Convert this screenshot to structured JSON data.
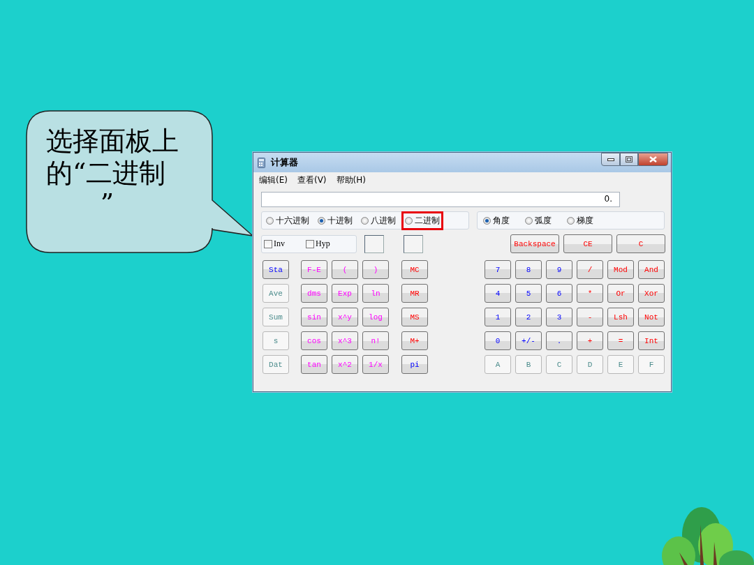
{
  "callout": {
    "lines": [
      "选择面板上",
      "的“二进制",
      "”"
    ]
  },
  "calculator": {
    "title": "计算器",
    "menu": [
      "编辑(E)",
      "查看(V)",
      "帮助(H)"
    ],
    "display": "0.",
    "number_systems": [
      {
        "label": "十六进制",
        "selected": false,
        "highlighted": false
      },
      {
        "label": "十进制",
        "selected": true,
        "highlighted": false
      },
      {
        "label": "八进制",
        "selected": false,
        "highlighted": false
      },
      {
        "label": "二进制",
        "selected": false,
        "highlighted": true
      }
    ],
    "angle_units": [
      {
        "label": "角度",
        "selected": true
      },
      {
        "label": "弧度",
        "selected": false
      },
      {
        "label": "梯度",
        "selected": false
      }
    ],
    "checkboxes": [
      {
        "label": "Inv",
        "checked": false
      },
      {
        "label": "Hyp",
        "checked": false
      }
    ],
    "edit_keys": [
      {
        "label": "Backspace",
        "kind": "operator"
      },
      {
        "label": "CE",
        "kind": "operator"
      },
      {
        "label": "C",
        "kind": "operator"
      }
    ],
    "stat_keys": [
      {
        "label": "Sta",
        "kind": "number",
        "disabled": false
      },
      {
        "label": "Ave",
        "kind": "number",
        "disabled": true
      },
      {
        "label": "Sum",
        "kind": "number",
        "disabled": true
      },
      {
        "label": "s",
        "kind": "number",
        "disabled": true
      },
      {
        "label": "Dat",
        "kind": "number",
        "disabled": true
      }
    ],
    "function_keys": [
      {
        "label": "F-E",
        "kind": "function",
        "disabled": false
      },
      {
        "label": "(",
        "kind": "function",
        "disabled": false
      },
      {
        "label": ")",
        "kind": "function",
        "disabled": false
      },
      {
        "label": "dms",
        "kind": "function",
        "disabled": false
      },
      {
        "label": "Exp",
        "kind": "function",
        "disabled": false
      },
      {
        "label": "ln",
        "kind": "function",
        "disabled": false
      },
      {
        "label": "sin",
        "kind": "function",
        "disabled": false
      },
      {
        "label": "x^y",
        "kind": "function",
        "disabled": false
      },
      {
        "label": "log",
        "kind": "function",
        "disabled": false
      },
      {
        "label": "cos",
        "kind": "function",
        "disabled": false
      },
      {
        "label": "x^3",
        "kind": "function",
        "disabled": false
      },
      {
        "label": "n!",
        "kind": "function",
        "disabled": false
      },
      {
        "label": "tan",
        "kind": "function",
        "disabled": false
      },
      {
        "label": "x^2",
        "kind": "function",
        "disabled": false
      },
      {
        "label": "1/x",
        "kind": "function",
        "disabled": false
      }
    ],
    "memory_keys": [
      {
        "label": "MC",
        "kind": "operator",
        "disabled": false
      },
      {
        "label": "MR",
        "kind": "operator",
        "disabled": false
      },
      {
        "label": "MS",
        "kind": "operator",
        "disabled": false
      },
      {
        "label": "M+",
        "kind": "operator",
        "disabled": false
      },
      {
        "label": "pi",
        "kind": "number",
        "disabled": false
      }
    ],
    "number_keys": [
      {
        "label": "7",
        "kind": "number",
        "disabled": false
      },
      {
        "label": "8",
        "kind": "number",
        "disabled": false
      },
      {
        "label": "9",
        "kind": "number",
        "disabled": false
      },
      {
        "label": "/",
        "kind": "operator",
        "disabled": false
      },
      {
        "label": "Mod",
        "kind": "operator",
        "disabled": false
      },
      {
        "label": "And",
        "kind": "operator",
        "disabled": false
      },
      {
        "label": "4",
        "kind": "number",
        "disabled": false
      },
      {
        "label": "5",
        "kind": "number",
        "disabled": false
      },
      {
        "label": "6",
        "kind": "number",
        "disabled": false
      },
      {
        "label": "*",
        "kind": "operator",
        "disabled": false
      },
      {
        "label": "Or",
        "kind": "operator",
        "disabled": false
      },
      {
        "label": "Xor",
        "kind": "operator",
        "disabled": false
      },
      {
        "label": "1",
        "kind": "number",
        "disabled": false
      },
      {
        "label": "2",
        "kind": "number",
        "disabled": false
      },
      {
        "label": "3",
        "kind": "number",
        "disabled": false
      },
      {
        "label": "-",
        "kind": "operator",
        "disabled": false
      },
      {
        "label": "Lsh",
        "kind": "operator",
        "disabled": false
      },
      {
        "label": "Not",
        "kind": "operator",
        "disabled": false
      },
      {
        "label": "0",
        "kind": "number",
        "disabled": false
      },
      {
        "label": "+/-",
        "kind": "number",
        "disabled": false
      },
      {
        "label": ".",
        "kind": "number",
        "disabled": false
      },
      {
        "label": "+",
        "kind": "operator",
        "disabled": false
      },
      {
        "label": "=",
        "kind": "operator",
        "disabled": false
      },
      {
        "label": "Int",
        "kind": "operator",
        "disabled": false
      },
      {
        "label": "A",
        "kind": "number",
        "disabled": true
      },
      {
        "label": "B",
        "kind": "number",
        "disabled": true
      },
      {
        "label": "C",
        "kind": "number",
        "disabled": true
      },
      {
        "label": "D",
        "kind": "number",
        "disabled": true
      },
      {
        "label": "E",
        "kind": "number",
        "disabled": true
      },
      {
        "label": "F",
        "kind": "number",
        "disabled": true
      }
    ]
  }
}
